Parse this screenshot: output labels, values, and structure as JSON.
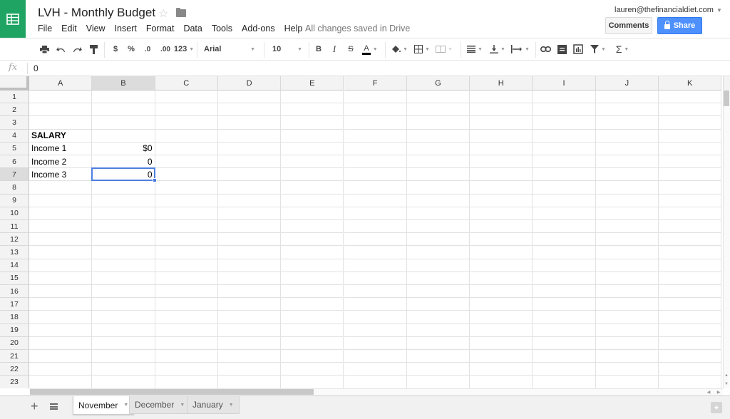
{
  "app": {
    "doc_title": "LVH - Monthly Budget",
    "save_status": "All changes saved in Drive",
    "account_email": "lauren@thefinancialdiet.com",
    "brand_color": "#1fa463",
    "share_color": "#4d90fe"
  },
  "menu": [
    "File",
    "Edit",
    "View",
    "Insert",
    "Format",
    "Data",
    "Tools",
    "Add-ons",
    "Help"
  ],
  "header_buttons": {
    "comments": "Comments",
    "share": "Share"
  },
  "toolbar": {
    "currency": "$",
    "percent": "%",
    "decrease_decimals": ".0",
    "increase_decimals": ".00",
    "more_formats": "123",
    "font": "Arial",
    "font_size": "10",
    "bold": "B",
    "italic": "I",
    "strikethrough": "S",
    "text_color": "A",
    "functions": "Σ"
  },
  "formula_bar": {
    "label": "fx",
    "value": "0"
  },
  "grid": {
    "columns": [
      "A",
      "B",
      "C",
      "D",
      "E",
      "F",
      "G",
      "H",
      "I",
      "J",
      "K"
    ],
    "rows": [
      "1",
      "2",
      "3",
      "4",
      "5",
      "6",
      "7",
      "8",
      "9",
      "10",
      "11",
      "12",
      "13",
      "14",
      "15",
      "16",
      "17",
      "18",
      "19",
      "20",
      "21",
      "22",
      "23"
    ],
    "selected_cell": "B7",
    "cells": {
      "A4": "SALARY",
      "A5": "Income 1",
      "B5": "$0",
      "A6": "Income 2",
      "B6": "0",
      "A7": "Income 3",
      "B7": "0"
    }
  },
  "sheets": [
    {
      "name": "November",
      "active": true
    },
    {
      "name": "December",
      "active": false
    },
    {
      "name": "January",
      "active": false
    }
  ]
}
